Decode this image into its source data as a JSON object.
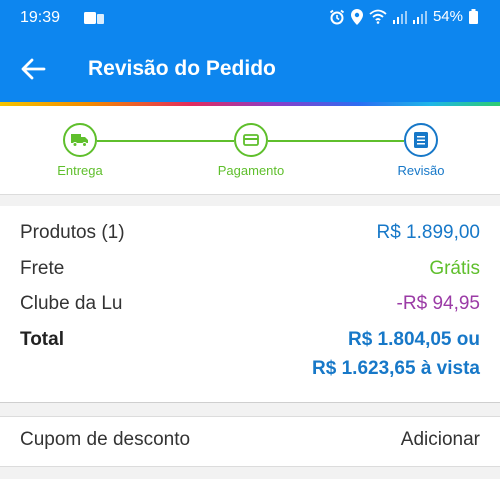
{
  "status_bar": {
    "time": "19:39",
    "battery": "54%",
    "icons": [
      "notification-icon",
      "alarm-icon",
      "location-icon",
      "wifi-icon",
      "signal-icon",
      "signal-icon",
      "battery-icon"
    ]
  },
  "app_bar": {
    "title": "Revisão do Pedido",
    "back_icon": "arrow-left-icon"
  },
  "stepper": {
    "steps": [
      {
        "label": "Entrega",
        "icon": "truck-icon",
        "state": "done"
      },
      {
        "label": "Pagamento",
        "icon": "card-icon",
        "state": "done"
      },
      {
        "label": "Revisão",
        "icon": "document-icon",
        "state": "current"
      }
    ]
  },
  "summary": {
    "products_label": "Produtos (1)",
    "products_value": "R$ 1.899,00",
    "shipping_label": "Frete",
    "shipping_value": "Grátis",
    "club_label": "Clube da Lu",
    "club_value": "-R$ 94,95",
    "total_label": "Total",
    "total_value_line1": "R$ 1.804,05 ou",
    "total_value_line2": "R$ 1.623,65 à vista"
  },
  "coupon": {
    "label": "Cupom de desconto",
    "action": "Adicionar"
  },
  "colors": {
    "primary": "#0d86ef",
    "green": "#5fbf2c",
    "price_blue": "#1778c8",
    "discount_purple": "#9b3ba6"
  }
}
